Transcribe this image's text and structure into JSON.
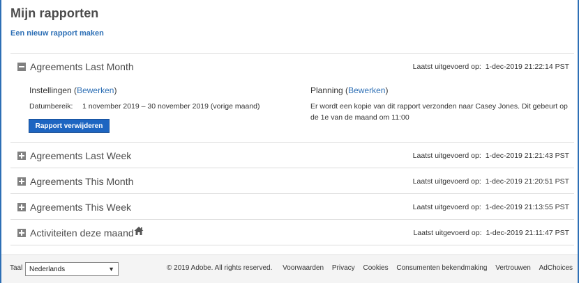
{
  "page": {
    "title": "Mijn rapporten",
    "new_report_link": "Een nieuw rapport maken"
  },
  "reports": [
    {
      "name": "Agreements Last Month",
      "last_run_label": "Laatst uitgevoerd op:",
      "last_run_value": "1-dec-2019 21:22:14 PST",
      "expanded": true,
      "settings_label": "Instellingen",
      "edit_label": "Bewerken",
      "date_range_label": "Datumbereik:",
      "date_range_value": "1 november 2019 – 30 november 2019 (vorige maand)",
      "delete_label": "Rapport verwijderen",
      "schedule_label": "Planning",
      "schedule_text": "Er wordt een kopie van dit rapport verzonden naar Casey Jones. Dit gebeurt op de 1e van de maand om 11:00"
    },
    {
      "name": "Agreements Last Week",
      "last_run_label": "Laatst uitgevoerd op:",
      "last_run_value": "1-dec-2019 21:21:43 PST",
      "expanded": false
    },
    {
      "name": "Agreements This Month",
      "last_run_label": "Laatst uitgevoerd op:",
      "last_run_value": "1-dec-2019 21:20:51 PST",
      "expanded": false
    },
    {
      "name": "Agreements This Week",
      "last_run_label": "Laatst uitgevoerd op:",
      "last_run_value": "1-dec-2019 21:13:55 PST",
      "expanded": false
    },
    {
      "name": "Activiteiten deze maand",
      "last_run_label": "Laatst uitgevoerd op:",
      "last_run_value": "1-dec-2019 21:11:47 PST",
      "expanded": false,
      "icon": "home-icon"
    }
  ],
  "footer": {
    "language_label": "Taal",
    "language_value": "Nederlands",
    "copyright": "© 2019 Adobe. All rights reserved.",
    "links": [
      "Voorwaarden",
      "Privacy",
      "Cookies",
      "Consumenten bekendmaking",
      "Vertrouwen",
      "AdChoices"
    ]
  },
  "colors": {
    "accent": "#2d6fb5",
    "button": "#1d65c1",
    "footer_bg": "#f4f4f4"
  }
}
